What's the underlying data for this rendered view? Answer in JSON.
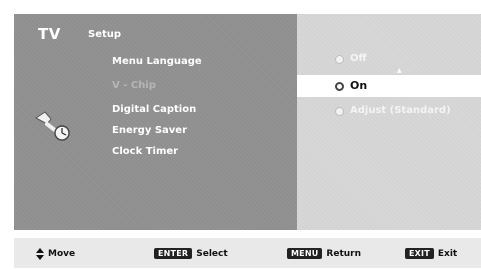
{
  "header": {
    "tv_label": "TV",
    "section_label": "Setup"
  },
  "menu": {
    "items": [
      {
        "label": "Menu Language"
      },
      {
        "label": "V - Chip"
      },
      {
        "label": "Digital Caption"
      },
      {
        "label": "Energy Saver"
      },
      {
        "label": "Clock Timer"
      }
    ],
    "active_item": "V - Chip"
  },
  "options": {
    "items": [
      {
        "label": "Off"
      },
      {
        "label": "On"
      },
      {
        "label": "Adjust (Standard)"
      }
    ],
    "selected": "On"
  },
  "footer": {
    "move_label": "Move",
    "enter_key": "ENTER",
    "select_label": "Select",
    "menu_key": "MENU",
    "return_label": "Return",
    "exit_key": "EXIT",
    "exit_label": "Exit"
  },
  "colors": {
    "left_panel": "#8f8f8f",
    "right_panel": "#d7d7d7",
    "selection": "#ffffff",
    "bottom_bar": "#e9e9e9"
  }
}
